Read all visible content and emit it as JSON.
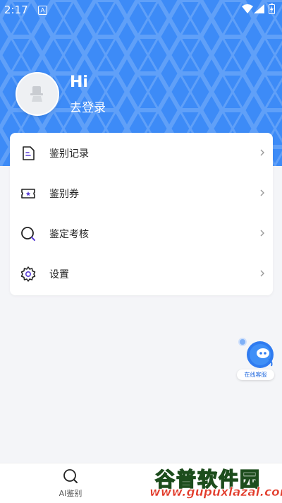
{
  "status_bar": {
    "time": "2:17",
    "notification_icon": "A"
  },
  "profile": {
    "greeting": "Hi",
    "login_text": "去登录",
    "avatar_icon": "default-avatar-icon"
  },
  "menu": {
    "items": [
      {
        "label": "鉴别记录",
        "icon": "document-icon"
      },
      {
        "label": "鉴别券",
        "icon": "ticket-icon"
      },
      {
        "label": "鉴定考核",
        "icon": "search-icon"
      },
      {
        "label": "设置",
        "icon": "gear-icon"
      }
    ]
  },
  "customer_service": {
    "label": "在线客服"
  },
  "bottom_nav": {
    "tabs": [
      {
        "label": "AI鉴别",
        "icon": "search-icon"
      }
    ]
  },
  "watermark": {
    "title": "谷普软件园",
    "url": "www.gupuxlazal.com"
  },
  "colors": {
    "header_bg": "#3d8bf7",
    "accent": "#5b3fd6",
    "page_bg": "#f4f5f8"
  }
}
